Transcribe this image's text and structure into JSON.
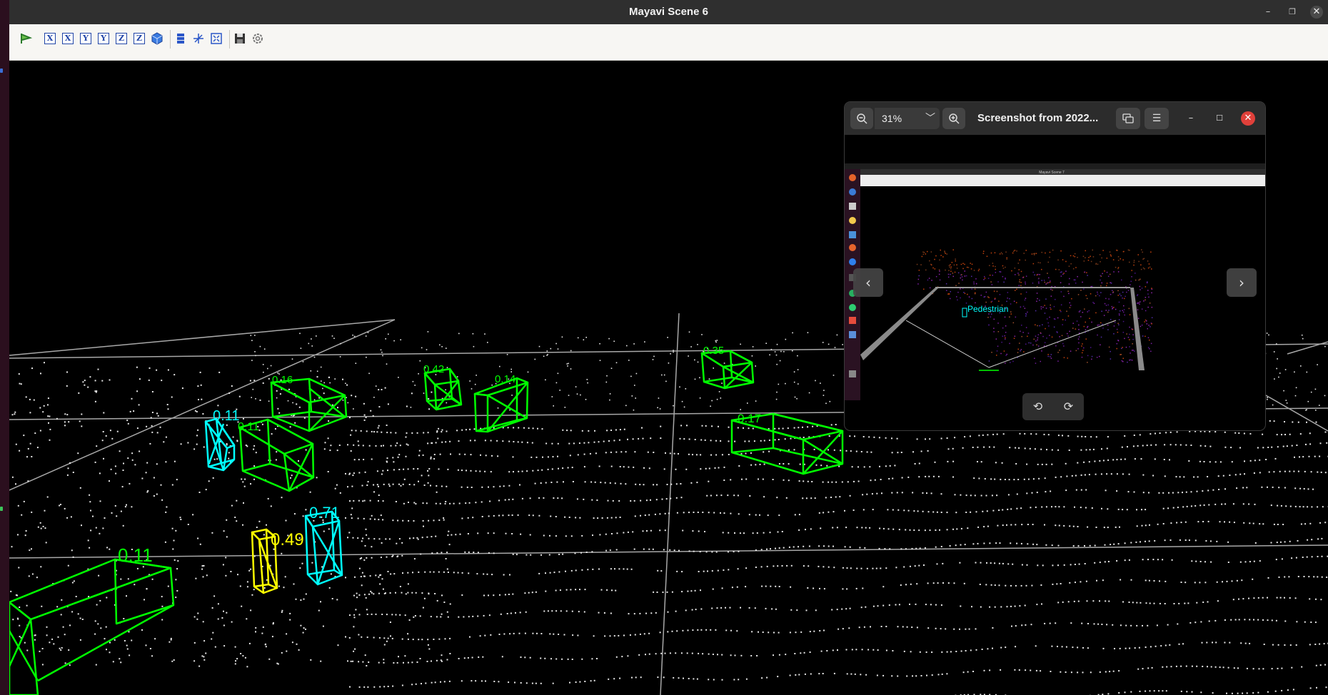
{
  "window": {
    "title": "Mayavi Scene 6"
  },
  "toolbar": {
    "axis_buttons": [
      "X",
      "X",
      "Y",
      "Y",
      "Z",
      "Z"
    ]
  },
  "detections": [
    {
      "score": "0.11",
      "color": "#00ffff"
    },
    {
      "score": "0.11",
      "color": "#00ff00"
    },
    {
      "score": "0.16",
      "color": "#00ff00"
    },
    {
      "score": "0.42",
      "color": "#00ff00"
    },
    {
      "score": "0.14",
      "color": "#00ff00"
    },
    {
      "score": "0.35",
      "color": "#00ff00"
    },
    {
      "score": "0.17",
      "color": "#00ff00"
    },
    {
      "score": "0.71",
      "color": "#00ffff"
    },
    {
      "score": "0.49",
      "color": "#ffff00"
    },
    {
      "score": "0.11",
      "color": "#00ff00"
    }
  ],
  "viewer": {
    "zoom": "31%",
    "title": "Screenshot from 2022...",
    "thumbnail": {
      "window_title": "Mayavi Scene 7",
      "label": "Pedestrian"
    }
  }
}
